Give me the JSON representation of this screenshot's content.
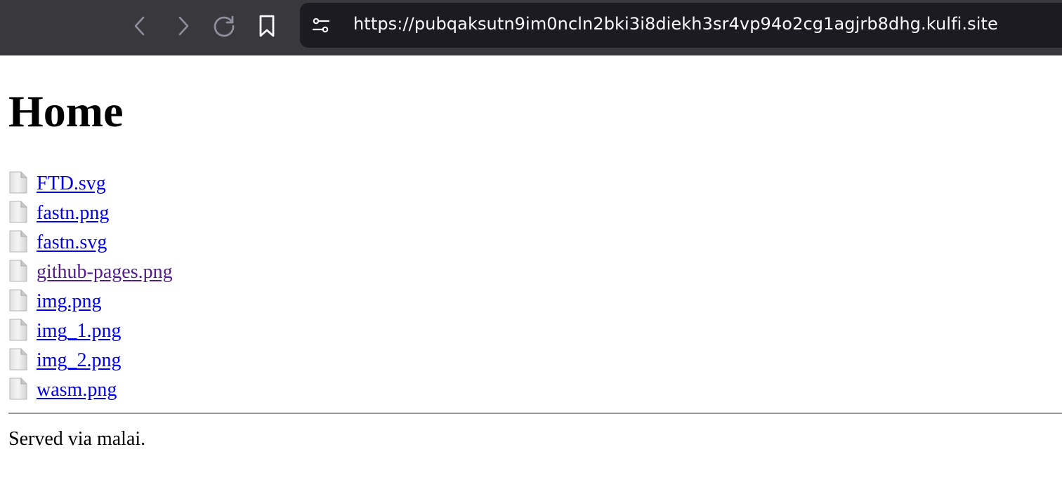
{
  "browser": {
    "url": "https://pubqaksutn9im0ncln2bki3i8diekh3sr4vp94o2cg1agjrb8dhg.kulfi.site",
    "icons": [
      "back-icon",
      "forward-icon",
      "reload-icon",
      "bookmark-icon",
      "site-info-icon"
    ]
  },
  "page": {
    "title": "Home",
    "files": [
      {
        "name": "FTD.svg",
        "visited": false
      },
      {
        "name": "fastn.png",
        "visited": false
      },
      {
        "name": "fastn.svg",
        "visited": false
      },
      {
        "name": "github-pages.png",
        "visited": true
      },
      {
        "name": "img.png",
        "visited": false
      },
      {
        "name": "img_1.png",
        "visited": false
      },
      {
        "name": "img_2.png",
        "visited": false
      },
      {
        "name": "wasm.png",
        "visited": false
      }
    ],
    "footer": "Served via malai."
  },
  "colors": {
    "toolbar_bg": "#38383d",
    "urlbar_bg": "#1c1b22",
    "link": "#0000ee",
    "visited_link": "#551a8b"
  }
}
